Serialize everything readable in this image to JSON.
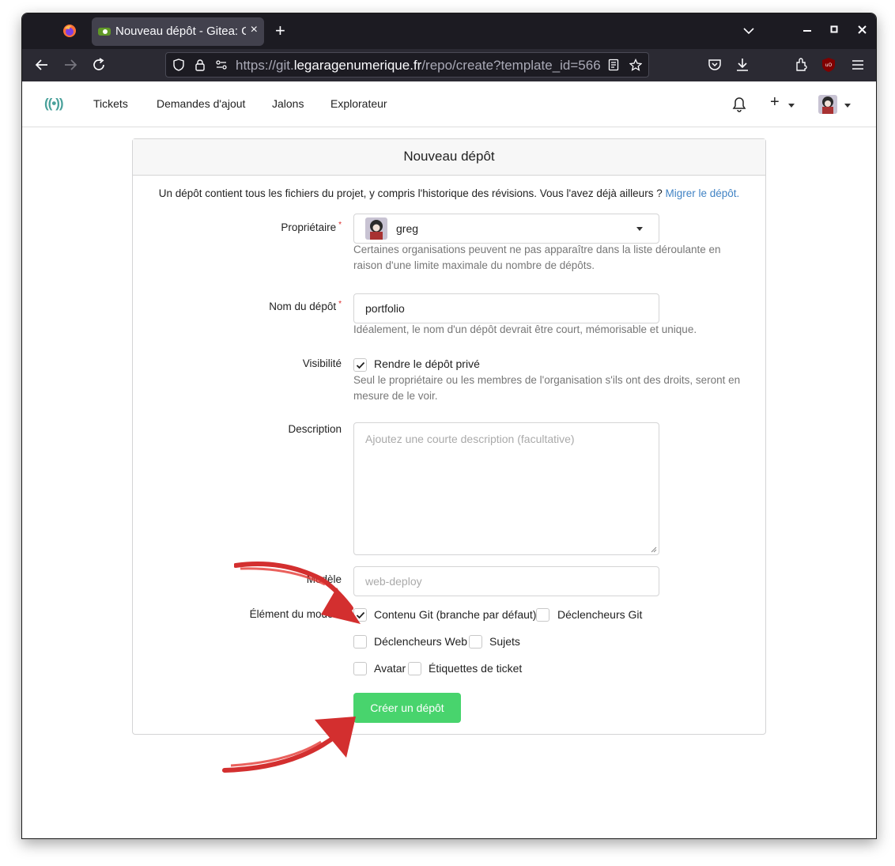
{
  "browser": {
    "tab_title": "Nouveau dépôt - Gitea: Git with a cup of tea",
    "tab_close": "×",
    "new_tab": "+",
    "url_prefix": "https://git.",
    "url_host": "legaragenumerique.fr",
    "url_path": "/repo/create?template_id=566"
  },
  "header": {
    "logo": "((•))",
    "nav": [
      "Tickets",
      "Demandes d'ajout",
      "Jalons",
      "Explorateur"
    ],
    "plus": "+"
  },
  "form": {
    "title": "Nouveau dépôt",
    "intro": "Un dépôt contient tous les fichiers du projet, y compris l'historique des révisions. Vous l'avez déjà ailleurs ?",
    "intro_link": "Migrer le dépôt.",
    "owner_label": "Propriétaire",
    "owner_value": "greg",
    "owner_help": "Certaines organisations peuvent ne pas apparaître dans la liste déroulante en raison d'une limite maximale du nombre de dépôts.",
    "name_label": "Nom du dépôt",
    "name_value": "portfolio",
    "name_help": "Idéalement, le nom d'un dépôt devrait être court, mémorisable et unique.",
    "visibility_label": "Visibilité",
    "visibility_checkbox": "Rendre le dépôt privé",
    "visibility_help": "Seul le propriétaire ou les membres de l'organisation s'ils ont des droits, seront en mesure de le voir.",
    "description_label": "Description",
    "description_placeholder": "Ajoutez une courte description (facultative)",
    "template_label": "Modèle",
    "template_placeholder": "web-deploy",
    "template_items_label": "Élément du modèle",
    "template_items": [
      {
        "label": "Contenu Git (branche par défaut)",
        "checked": true
      },
      {
        "label": "Déclencheurs Git",
        "checked": false
      },
      {
        "label": "Déclencheurs Web",
        "checked": false
      },
      {
        "label": "Sujets",
        "checked": false
      },
      {
        "label": "Avatar",
        "checked": false
      },
      {
        "label": "Étiquettes de ticket",
        "checked": false
      }
    ],
    "visibility_checked": true,
    "submit": "Créer un dépôt"
  },
  "colors": {
    "accent_green": "#48d46d",
    "link_blue": "#4183c4",
    "logo_teal": "#4aa19b",
    "annotation_red": "#d32f2f"
  }
}
